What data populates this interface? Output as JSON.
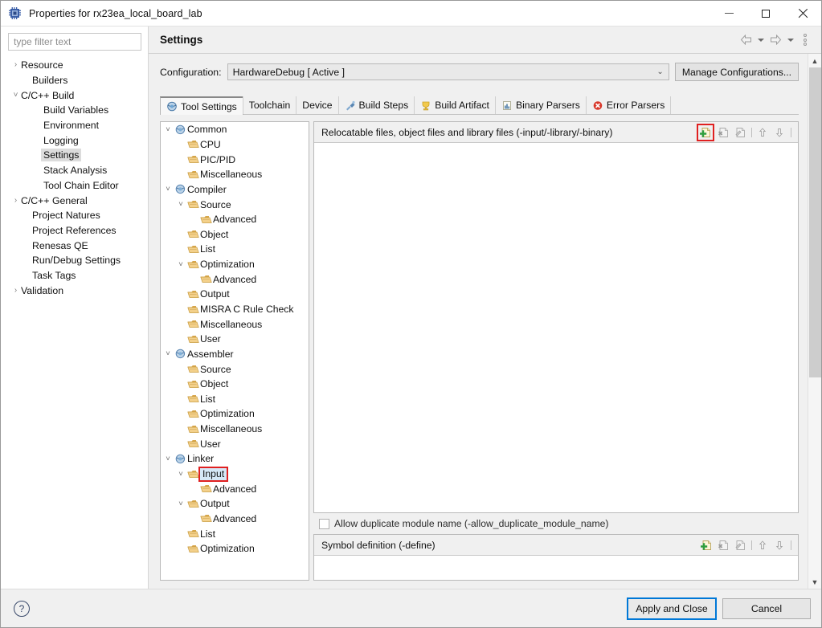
{
  "window": {
    "title": "Properties for rx23ea_local_board_lab",
    "icon": "chip-icon",
    "controls": {
      "minimize": "Minimize",
      "maximize": "Maximize",
      "close": "Close"
    }
  },
  "left_nav": {
    "filter_placeholder": "type filter text",
    "filter_value": "",
    "items": [
      {
        "label": "Resource",
        "indent": 0,
        "twisty": "collapsed",
        "selected": false
      },
      {
        "label": "Builders",
        "indent": 1,
        "twisty": "none",
        "selected": false
      },
      {
        "label": "C/C++ Build",
        "indent": 0,
        "twisty": "expanded",
        "selected": false
      },
      {
        "label": "Build Variables",
        "indent": 2,
        "twisty": "none",
        "selected": false
      },
      {
        "label": "Environment",
        "indent": 2,
        "twisty": "none",
        "selected": false
      },
      {
        "label": "Logging",
        "indent": 2,
        "twisty": "none",
        "selected": false
      },
      {
        "label": "Settings",
        "indent": 2,
        "twisty": "none",
        "selected": true
      },
      {
        "label": "Stack Analysis",
        "indent": 2,
        "twisty": "none",
        "selected": false
      },
      {
        "label": "Tool Chain Editor",
        "indent": 2,
        "twisty": "none",
        "selected": false
      },
      {
        "label": "C/C++ General",
        "indent": 0,
        "twisty": "collapsed",
        "selected": false
      },
      {
        "label": "Project Natures",
        "indent": 1,
        "twisty": "none",
        "selected": false
      },
      {
        "label": "Project References",
        "indent": 1,
        "twisty": "none",
        "selected": false
      },
      {
        "label": "Renesas QE",
        "indent": 1,
        "twisty": "none",
        "selected": false
      },
      {
        "label": "Run/Debug Settings",
        "indent": 1,
        "twisty": "none",
        "selected": false
      },
      {
        "label": "Task Tags",
        "indent": 1,
        "twisty": "none",
        "selected": false
      },
      {
        "label": "Validation",
        "indent": 0,
        "twisty": "collapsed",
        "selected": false
      }
    ]
  },
  "pane": {
    "title": "Settings",
    "header_tools": [
      {
        "name": "back-arrow-icon",
        "label": "Back"
      },
      {
        "name": "back-dropdown-icon",
        "label": "Back history"
      },
      {
        "name": "forward-arrow-icon",
        "label": "Forward"
      },
      {
        "name": "forward-dropdown-icon",
        "label": "Forward history"
      },
      {
        "name": "view-menu-icon",
        "label": "View Menu"
      }
    ]
  },
  "configuration": {
    "label": "Configuration:",
    "value": "HardwareDebug  [ Active ]",
    "manage_button": "Manage Configurations..."
  },
  "tabs": [
    {
      "label": "Tool Settings",
      "icon": "tool-settings-icon",
      "active": true
    },
    {
      "label": "Toolchain",
      "icon": "none",
      "active": false
    },
    {
      "label": "Device",
      "icon": "none",
      "active": false
    },
    {
      "label": "Build Steps",
      "icon": "build-steps-icon",
      "active": false
    },
    {
      "label": "Build Artifact",
      "icon": "build-artifact-icon",
      "active": false
    },
    {
      "label": "Binary Parsers",
      "icon": "binary-parsers-icon",
      "active": false
    },
    {
      "label": "Error Parsers",
      "icon": "error-parsers-icon",
      "active": false
    }
  ],
  "tool_tree": [
    {
      "label": "Common",
      "indent": 0,
      "twisty": "expanded",
      "icon": "tool-icon",
      "selected": false
    },
    {
      "label": "CPU",
      "indent": 1,
      "twisty": "none",
      "icon": "folder-icon",
      "selected": false
    },
    {
      "label": "PIC/PID",
      "indent": 1,
      "twisty": "none",
      "icon": "folder-icon",
      "selected": false
    },
    {
      "label": "Miscellaneous",
      "indent": 1,
      "twisty": "none",
      "icon": "folder-icon",
      "selected": false
    },
    {
      "label": "Compiler",
      "indent": 0,
      "twisty": "expanded",
      "icon": "tool-icon",
      "selected": false
    },
    {
      "label": "Source",
      "indent": 1,
      "twisty": "expanded",
      "icon": "folder-icon",
      "selected": false
    },
    {
      "label": "Advanced",
      "indent": 2,
      "twisty": "none",
      "icon": "folder-icon",
      "selected": false
    },
    {
      "label": "Object",
      "indent": 1,
      "twisty": "none",
      "icon": "folder-icon",
      "selected": false
    },
    {
      "label": "List",
      "indent": 1,
      "twisty": "none",
      "icon": "folder-icon",
      "selected": false
    },
    {
      "label": "Optimization",
      "indent": 1,
      "twisty": "expanded",
      "icon": "folder-icon",
      "selected": false
    },
    {
      "label": "Advanced",
      "indent": 2,
      "twisty": "none",
      "icon": "folder-icon",
      "selected": false
    },
    {
      "label": "Output",
      "indent": 1,
      "twisty": "none",
      "icon": "folder-icon",
      "selected": false
    },
    {
      "label": "MISRA C Rule Check",
      "indent": 1,
      "twisty": "none",
      "icon": "folder-icon",
      "selected": false
    },
    {
      "label": "Miscellaneous",
      "indent": 1,
      "twisty": "none",
      "icon": "folder-icon",
      "selected": false
    },
    {
      "label": "User",
      "indent": 1,
      "twisty": "none",
      "icon": "folder-icon",
      "selected": false
    },
    {
      "label": "Assembler",
      "indent": 0,
      "twisty": "expanded",
      "icon": "tool-icon",
      "selected": false
    },
    {
      "label": "Source",
      "indent": 1,
      "twisty": "none",
      "icon": "folder-icon",
      "selected": false
    },
    {
      "label": "Object",
      "indent": 1,
      "twisty": "none",
      "icon": "folder-icon",
      "selected": false
    },
    {
      "label": "List",
      "indent": 1,
      "twisty": "none",
      "icon": "folder-icon",
      "selected": false
    },
    {
      "label": "Optimization",
      "indent": 1,
      "twisty": "none",
      "icon": "folder-icon",
      "selected": false
    },
    {
      "label": "Miscellaneous",
      "indent": 1,
      "twisty": "none",
      "icon": "folder-icon",
      "selected": false
    },
    {
      "label": "User",
      "indent": 1,
      "twisty": "none",
      "icon": "folder-icon",
      "selected": false
    },
    {
      "label": "Linker",
      "indent": 0,
      "twisty": "expanded",
      "icon": "tool-icon",
      "selected": false
    },
    {
      "label": "Input",
      "indent": 1,
      "twisty": "expanded",
      "icon": "folder-icon",
      "selected": true
    },
    {
      "label": "Advanced",
      "indent": 2,
      "twisty": "none",
      "icon": "folder-icon",
      "selected": false
    },
    {
      "label": "Output",
      "indent": 1,
      "twisty": "expanded",
      "icon": "folder-icon",
      "selected": false
    },
    {
      "label": "Advanced",
      "indent": 2,
      "twisty": "none",
      "icon": "folder-icon",
      "selected": false
    },
    {
      "label": "List",
      "indent": 1,
      "twisty": "none",
      "icon": "folder-icon",
      "selected": false
    },
    {
      "label": "Optimization",
      "indent": 1,
      "twisty": "none",
      "icon": "folder-icon",
      "selected": false
    }
  ],
  "relocatable_group": {
    "title": "Relocatable files, object files and library files (-input/-library/-binary)",
    "tools": [
      {
        "name": "add-icon",
        "label": "Add",
        "highlighted": true
      },
      {
        "name": "delete-icon",
        "label": "Delete",
        "highlighted": false
      },
      {
        "name": "edit-icon",
        "label": "Edit",
        "highlighted": false
      },
      {
        "name": "move-up-icon",
        "label": "Move Up",
        "highlighted": false
      },
      {
        "name": "move-down-icon",
        "label": "Move Down",
        "highlighted": false
      }
    ],
    "entries": []
  },
  "allow_duplicate": {
    "label": "Allow duplicate module name (-allow_duplicate_module_name)",
    "checked": false
  },
  "symbol_group": {
    "title": "Symbol definition (-define)",
    "tools": [
      {
        "name": "add-icon",
        "label": "Add",
        "highlighted": false
      },
      {
        "name": "delete-icon",
        "label": "Delete",
        "highlighted": false
      },
      {
        "name": "edit-icon",
        "label": "Edit",
        "highlighted": false
      },
      {
        "name": "move-up-icon",
        "label": "Move Up",
        "highlighted": false
      },
      {
        "name": "move-down-icon",
        "label": "Move Down",
        "highlighted": false
      }
    ],
    "entries": []
  },
  "footer": {
    "help": "?",
    "apply_and_close": "Apply and Close",
    "cancel": "Cancel"
  },
  "colors": {
    "accent_focus": "#0078d7",
    "highlight_red": "#e02020",
    "selection_gray": "#dcdcdc",
    "panel_bg": "#f0f0f0",
    "folder_icon": "#e8b96a",
    "tool_icon": "#7aa7d0"
  }
}
